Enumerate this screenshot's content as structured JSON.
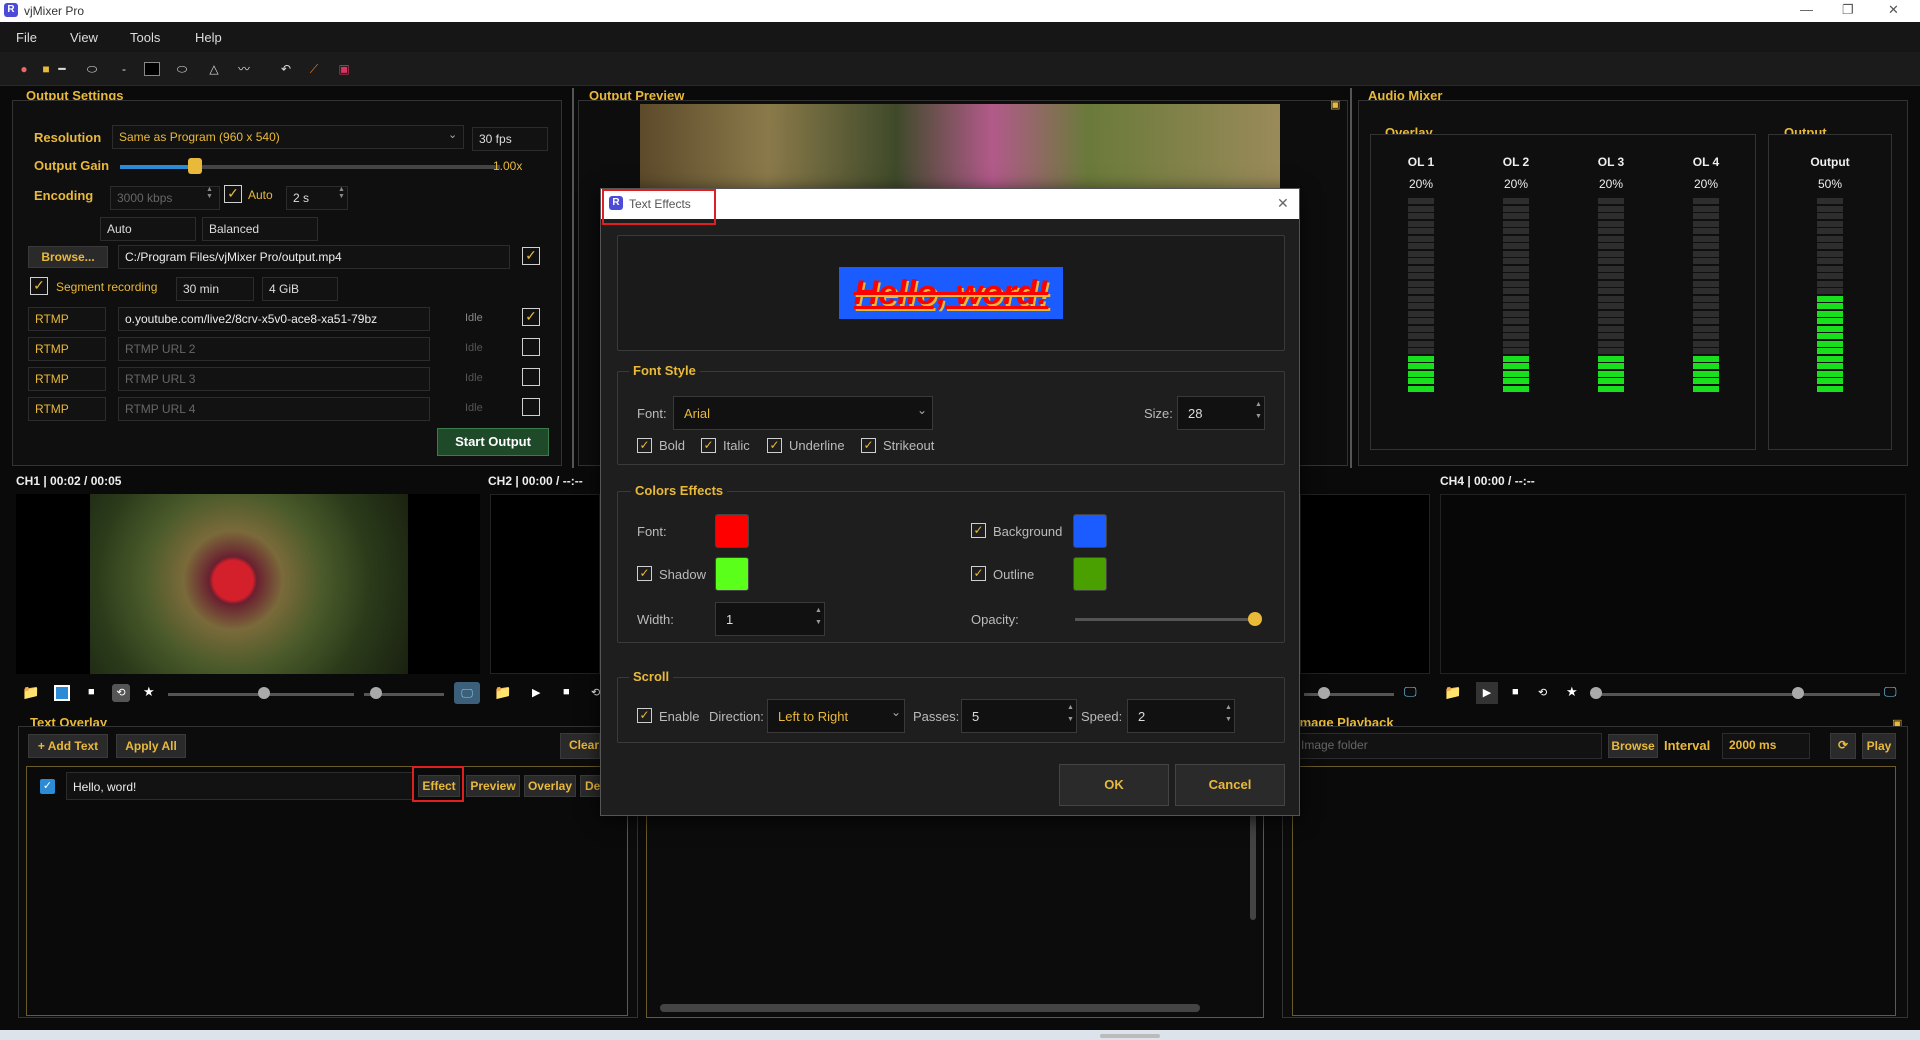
{
  "app": {
    "title": "vjMixer Pro",
    "logo": "R"
  },
  "menu": [
    "File",
    "View",
    "Tools",
    "Help"
  ],
  "output_settings": {
    "title": "Output Settings",
    "resolution_label": "Resolution",
    "resolution_value": "Same as Program (960 x 540)",
    "fps": "30 fps",
    "gain_label": "Output Gain",
    "gain_value": "1.00x",
    "encoding_label": "Encoding",
    "bitrate": "3000 kbps",
    "auto_label": "Auto",
    "keyframe": "2 s",
    "preset": "Auto",
    "tune": "Balanced",
    "browse_label": "Browse...",
    "path": "C:/Program Files/vjMixer Pro/output.mp4",
    "segment_label": "Segment recording",
    "segment_time": "30 min",
    "segment_size": "4 GiB",
    "rtmp": [
      {
        "proto": "RTMP",
        "url": "o.youtube.com/live2/8crv-x5v0-ace8-xa51-79bz",
        "placeholder": "",
        "status": "Idle",
        "checked": true
      },
      {
        "proto": "RTMP",
        "url": "",
        "placeholder": "RTMP URL 2",
        "status": "Idle",
        "checked": false
      },
      {
        "proto": "RTMP",
        "url": "",
        "placeholder": "RTMP URL 3",
        "status": "Idle",
        "checked": false
      },
      {
        "proto": "RTMP",
        "url": "",
        "placeholder": "RTMP URL 4",
        "status": "Idle",
        "checked": false
      }
    ],
    "start_label": "Start Output"
  },
  "output_preview": {
    "title": "Output Preview"
  },
  "audio_mixer": {
    "title": "Audio Mixer",
    "overlay_title": "Overlay",
    "output_title": "Output",
    "channels": [
      {
        "name": "OL 1",
        "level": "20%",
        "fill": 0.2
      },
      {
        "name": "OL 2",
        "level": "20%",
        "fill": 0.2
      },
      {
        "name": "OL 3",
        "level": "20%",
        "fill": 0.2
      },
      {
        "name": "OL 4",
        "level": "20%",
        "fill": 0.2
      }
    ],
    "output": {
      "name": "Output",
      "level": "50%",
      "fill": 0.5
    }
  },
  "channels": {
    "ch1": "CH1 | 00:02 / 00:05",
    "ch2": "CH2 | 00:00 / --:--",
    "ch4": "CH4 | 00:00 / --:--"
  },
  "text_overlay": {
    "title": "Text Overlay",
    "add_label": "+ Add Text",
    "apply_label": "Apply All",
    "clear_label": "Clear",
    "item_text": "Hello, word!",
    "effect_label": "Effect",
    "preview_label": "Preview",
    "overlay_label": "Overlay",
    "delete_label": "De"
  },
  "image_playback": {
    "title": "Image Playback",
    "folder_placeholder": "Image folder",
    "browse_label": "Browse",
    "interval_label": "Interval",
    "interval_value": "2000 ms",
    "play_label": "Play"
  },
  "dialog": {
    "title": "Text Effects",
    "preview_text": "Hello, word!",
    "font_style_title": "Font Style",
    "font_label": "Font:",
    "font_value": "Arial",
    "size_label": "Size:",
    "size_value": "28",
    "bold_label": "Bold",
    "italic_label": "Italic",
    "underline_label": "Underline",
    "strikeout_label": "Strikeout",
    "colors_title": "Colors  Effects",
    "font_color_label": "Font:",
    "background_label": "Background",
    "shadow_label": "Shadow",
    "outline_label": "Outline",
    "width_label": "Width:",
    "width_value": "1",
    "opacity_label": "Opacity:",
    "scroll_title": "Scroll",
    "enable_label": "Enable",
    "direction_label": "Direction:",
    "direction_value": "Left to Right",
    "passes_label": "Passes:",
    "passes_value": "5",
    "speed_label": "Speed:",
    "speed_value": "2",
    "ok_label": "OK",
    "cancel_label": "Cancel",
    "colors": {
      "font": "#ff0000",
      "background": "#1a5cff",
      "shadow": "#5aff1a",
      "outline": "#4aa000"
    },
    "opacity": 1.0
  },
  "accent": "#e9b93a"
}
